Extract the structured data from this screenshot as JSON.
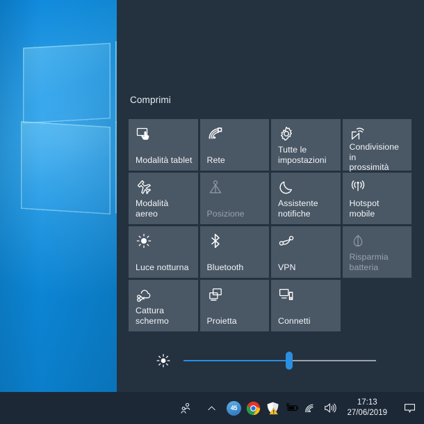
{
  "panel": {
    "collapse_label": "Comprimi",
    "background_color": "#24313f",
    "tile_color": "#4a5765",
    "accent_color": "#2a8fe0"
  },
  "tiles": [
    {
      "label": "Modalità tablet",
      "icon": "tablet-mode-icon",
      "state": "enabled"
    },
    {
      "label": "Rete",
      "icon": "network-icon",
      "state": "enabled"
    },
    {
      "label": "Tutte le\nimpostazioni",
      "icon": "settings-gear-icon",
      "state": "enabled"
    },
    {
      "label": "Condivisione in\nprossimità",
      "icon": "nearby-share-icon",
      "state": "enabled"
    },
    {
      "label": "Modalità aereo",
      "icon": "airplane-mode-icon",
      "state": "enabled"
    },
    {
      "label": "Posizione",
      "icon": "location-icon",
      "state": "disabled"
    },
    {
      "label": "Assistente\nnotifiche",
      "icon": "moon-focus-assist-icon",
      "state": "enabled"
    },
    {
      "label": "Hotspot mobile",
      "icon": "mobile-hotspot-icon",
      "state": "enabled"
    },
    {
      "label": "Luce notturna",
      "icon": "night-light-sun-icon",
      "state": "enabled"
    },
    {
      "label": "Bluetooth",
      "icon": "bluetooth-icon",
      "state": "enabled"
    },
    {
      "label": "VPN",
      "icon": "vpn-icon",
      "state": "enabled"
    },
    {
      "label": "Risparmia\nbatteria",
      "icon": "battery-saver-icon",
      "state": "disabled"
    },
    {
      "label": "Cattura\nschermo",
      "icon": "screen-snip-icon",
      "state": "enabled"
    },
    {
      "label": "Proietta",
      "icon": "project-display-icon",
      "state": "enabled"
    },
    {
      "label": "Connetti",
      "icon": "connect-device-icon",
      "state": "enabled"
    }
  ],
  "brightness": {
    "icon": "brightness-sun-icon",
    "value_percent": 55,
    "track_color": "#9aa3ad",
    "fill_color": "#2a8fe0"
  },
  "taskbar": {
    "people_icon": "people-icon",
    "chevron_icon": "chevron-up-icon",
    "tray_apps": [
      {
        "name": "update-count-icon",
        "badge": "45"
      },
      {
        "name": "chrome-icon"
      },
      {
        "name": "windows-defender-warning-icon"
      },
      {
        "name": "battery-charging-icon"
      }
    ],
    "network_icon": "wifi-icon",
    "volume_icon": "speaker-volume-icon",
    "clock": {
      "time": "17:13",
      "date": "27/06/2019"
    },
    "notification_icon": "action-center-icon"
  }
}
